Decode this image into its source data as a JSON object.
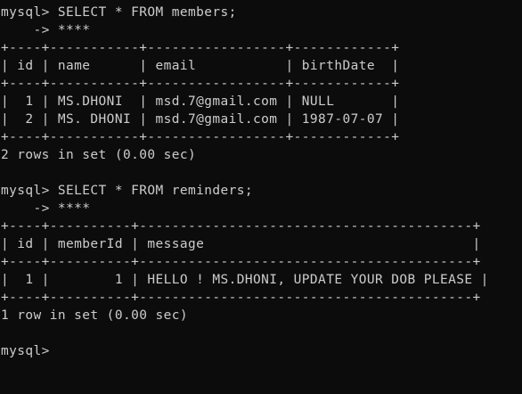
{
  "colors": {
    "background": "#0c0c0c",
    "text": "#cccccc"
  },
  "terminal": {
    "lines": [
      "mysql> SELECT * FROM members;",
      "    -> ****",
      "+----+-----------+-----------------+------------+",
      "| id | name      | email           | birthDate  |",
      "+----+-----------+-----------------+------------+",
      "|  1 | MS.DHONI  | msd.7@gmail.com | NULL       |",
      "|  2 | MS. DHONI | msd.7@gmail.com | 1987-07-07 |",
      "+----+-----------+-----------------+------------+",
      "2 rows in set (0.00 sec)",
      "",
      "mysql> SELECT * FROM reminders;",
      "    -> ****",
      "+----+----------+-----------------------------------------+",
      "| id | memberId | message                                 |",
      "+----+----------+-----------------------------------------+",
      "|  1 |        1 | HELLO ! MS.DHONI, UPDATE YOUR DOB PLEASE |",
      "+----+----------+-----------------------------------------+",
      "1 row in set (0.00 sec)",
      "",
      "mysql>"
    ]
  }
}
